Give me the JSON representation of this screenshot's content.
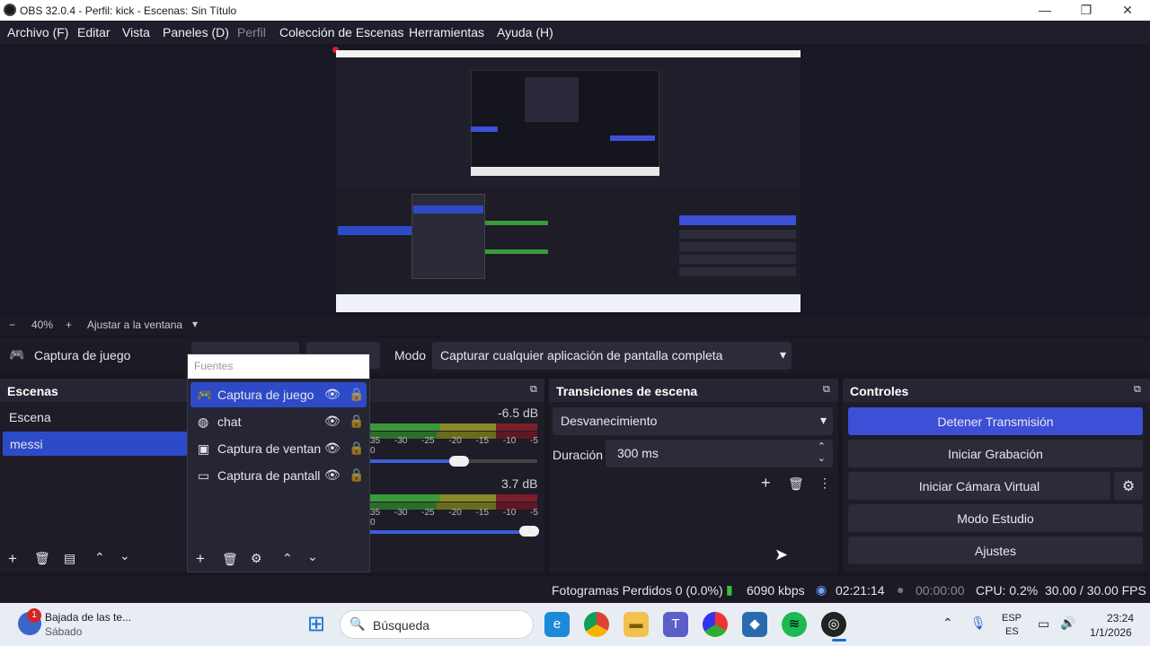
{
  "window": {
    "title": "OBS 32.0.4 - Perfil: kick - Escenas: Sin Título"
  },
  "menu": [
    "Archivo (F)",
    "Editar",
    "Vista",
    "Paneles (D)",
    "Perfil",
    "Colección de Escenas",
    "Herramientas",
    "Ayuda (H)"
  ],
  "zoom": {
    "minus": "−",
    "value": "40%",
    "plus": "+",
    "fit": "Ajustar a la ventana"
  },
  "source_bar": {
    "selected_source": "Captura de juego",
    "mode_label": "Modo",
    "mode_value": "Capturar cualquier aplicación de pantalla completa"
  },
  "scenes": {
    "title": "Escenas",
    "items": [
      "Escena",
      "messi"
    ],
    "active": "messi"
  },
  "sources": {
    "title": "Fuentes",
    "items": [
      "Captura de juego",
      "chat",
      "Captura de ventan",
      "Captura de pantall"
    ]
  },
  "mixer": {
    "db1": "-6.5 dB",
    "db2": "3.7 dB",
    "ticks": [
      "35",
      "-30",
      "-25",
      "-20",
      "-15",
      "-10",
      "-5",
      "0"
    ]
  },
  "transitions": {
    "title": "Transiciones de escena",
    "type": "Desvanecimiento",
    "duration_label": "Duración",
    "duration_value": "300 ms"
  },
  "controls": {
    "title": "Controles",
    "stop_stream": "Detener Transmisión",
    "start_rec": "Iniciar Grabación",
    "virtual_cam": "Iniciar Cámara Virtual",
    "studio": "Modo Estudio",
    "settings": "Ajustes"
  },
  "status": {
    "dropped": "Fotogramas Perdidos 0 (0.0%)",
    "kbps": "6090 kbps",
    "stream_time": "02:21:14",
    "rec_time": "00:00:00",
    "cpu": "CPU: 0.2%",
    "fps": "30.00 / 30.00 FPS"
  },
  "taskbar": {
    "notif_title": "Bajada de las te...",
    "notif_sub": "Sábado",
    "notif_badge": "1",
    "search": "Búsqueda",
    "lang1": "ESP",
    "lang2": "ES",
    "time": "23:24",
    "date": "1/1/2026"
  },
  "colors": {
    "accent": "#3d4fd6",
    "selection": "#2d4bc9",
    "bg": "#17171f"
  }
}
